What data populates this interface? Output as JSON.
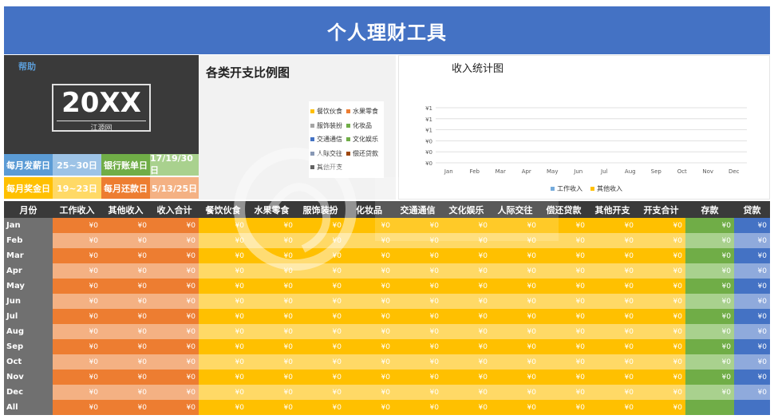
{
  "header": {
    "title": "个人理财工具"
  },
  "sidebar": {
    "help_label": "帮助",
    "year": "20XX",
    "year_sub": "江源网",
    "info": [
      {
        "label": "每月发薪日",
        "value": "25~30日",
        "label_color": "#5b9bd5",
        "value_color": "#9dc3e6"
      },
      {
        "label": "银行账单日",
        "value": "17/19/30日",
        "label_color": "#70ad47",
        "value_color": "#a9d18e"
      },
      {
        "label": "每月奖金日",
        "value": "19~23日",
        "label_color": "#ffc000",
        "value_color": "#ffd966"
      },
      {
        "label": "每月还款日",
        "value": "5/13/25日",
        "label_color": "#ed7d31",
        "value_color": "#f4b183"
      }
    ]
  },
  "pie_chart": {
    "title": "各类开支比例图",
    "legend": [
      {
        "label": "餐饮伙食",
        "color": "#ffc000"
      },
      {
        "label": "水果零食",
        "color": "#ed7d31"
      },
      {
        "label": "服饰装扮",
        "color": "#a5a5a5"
      },
      {
        "label": "化妆品",
        "color": "#70ad47"
      },
      {
        "label": "交通通信",
        "color": "#4472c4"
      },
      {
        "label": "文化娱乐",
        "color": "#70ad47"
      },
      {
        "label": "人际交往",
        "color": "#264478"
      },
      {
        "label": "偿还贷款",
        "color": "#9e480e"
      },
      {
        "label": "其他开支",
        "color": "#636363"
      }
    ]
  },
  "chart_data": {
    "type": "bar",
    "title": "收入统计图",
    "categories": [
      "Jan",
      "Feb",
      "Mar",
      "Apr",
      "May",
      "Jun",
      "Jul",
      "Aug",
      "Sep",
      "Oct",
      "Nov",
      "Dec"
    ],
    "y_tick_labels": [
      "¥1",
      "¥1",
      "¥1",
      "¥0",
      "¥0",
      "¥0"
    ],
    "series": [
      {
        "name": "工作收入",
        "color": "#5b9bd5",
        "values": [
          0,
          0,
          0,
          0,
          0,
          0,
          0,
          0,
          0,
          0,
          0,
          0
        ]
      },
      {
        "name": "其他收入",
        "color": "#ffc000",
        "values": [
          0,
          0,
          0,
          0,
          0,
          0,
          0,
          0,
          0,
          0,
          0,
          0
        ]
      }
    ],
    "grid": true,
    "legend_position": "bottom"
  },
  "table": {
    "columns": [
      {
        "label": "月份",
        "color": "#707070",
        "alt": "#707070"
      },
      {
        "label": "工作收入",
        "color": "#ed7d31",
        "alt": "#f4b183"
      },
      {
        "label": "其他收入",
        "color": "#ed7d31",
        "alt": "#f4b183"
      },
      {
        "label": "收入合计",
        "color": "#ed7d31",
        "alt": "#f4b183"
      },
      {
        "label": "餐饮伙食",
        "color": "#ffc000",
        "alt": "#ffd966"
      },
      {
        "label": "水果零食",
        "color": "#ffc000",
        "alt": "#ffd966"
      },
      {
        "label": "服饰装扮",
        "color": "#ffc000",
        "alt": "#ffd966"
      },
      {
        "label": "化妆品",
        "color": "#ffc000",
        "alt": "#ffd966"
      },
      {
        "label": "交通通信",
        "color": "#ffc000",
        "alt": "#ffd966"
      },
      {
        "label": "文化娱乐",
        "color": "#ffc000",
        "alt": "#ffd966"
      },
      {
        "label": "人际交往",
        "color": "#ffc000",
        "alt": "#ffd966"
      },
      {
        "label": "偿还贷款",
        "color": "#ffc000",
        "alt": "#ffd966"
      },
      {
        "label": "其他开支",
        "color": "#ffc000",
        "alt": "#ffd966"
      },
      {
        "label": "开支合计",
        "color": "#ffc000",
        "alt": "#ffd966"
      },
      {
        "label": "存款",
        "color": "#70ad47",
        "alt": "#a9d18e"
      },
      {
        "label": "贷款",
        "color": "#4472c4",
        "alt": "#8faadc"
      }
    ],
    "rows": [
      {
        "month": "Jan",
        "values": [
          "¥0",
          "¥0",
          "¥0",
          "¥0",
          "¥0",
          "¥0",
          "¥0",
          "¥0",
          "¥0",
          "¥0",
          "¥0",
          "¥0",
          "¥0",
          "¥0",
          "¥0"
        ]
      },
      {
        "month": "Feb",
        "values": [
          "¥0",
          "¥0",
          "¥0",
          "¥0",
          "¥0",
          "¥0",
          "¥0",
          "¥0",
          "¥0",
          "¥0",
          "¥0",
          "¥0",
          "¥0",
          "¥0",
          "¥0"
        ]
      },
      {
        "month": "Mar",
        "values": [
          "¥0",
          "¥0",
          "¥0",
          "¥0",
          "¥0",
          "¥0",
          "¥0",
          "¥0",
          "¥0",
          "¥0",
          "¥0",
          "¥0",
          "¥0",
          "¥0",
          "¥0"
        ]
      },
      {
        "month": "Apr",
        "values": [
          "¥0",
          "¥0",
          "¥0",
          "¥0",
          "¥0",
          "¥0",
          "¥0",
          "¥0",
          "¥0",
          "¥0",
          "¥0",
          "¥0",
          "¥0",
          "¥0",
          "¥0"
        ]
      },
      {
        "month": "May",
        "values": [
          "¥0",
          "¥0",
          "¥0",
          "¥0",
          "¥0",
          "¥0",
          "¥0",
          "¥0",
          "¥0",
          "¥0",
          "¥0",
          "¥0",
          "¥0",
          "¥0",
          "¥0"
        ]
      },
      {
        "month": "Jun",
        "values": [
          "¥0",
          "¥0",
          "¥0",
          "¥0",
          "¥0",
          "¥0",
          "¥0",
          "¥0",
          "¥0",
          "¥0",
          "¥0",
          "¥0",
          "¥0",
          "¥0",
          "¥0"
        ]
      },
      {
        "month": "Jul",
        "values": [
          "¥0",
          "¥0",
          "¥0",
          "¥0",
          "¥0",
          "¥0",
          "¥0",
          "¥0",
          "¥0",
          "¥0",
          "¥0",
          "¥0",
          "¥0",
          "¥0",
          "¥0"
        ]
      },
      {
        "month": "Aug",
        "values": [
          "¥0",
          "¥0",
          "¥0",
          "¥0",
          "¥0",
          "¥0",
          "¥0",
          "¥0",
          "¥0",
          "¥0",
          "¥0",
          "¥0",
          "¥0",
          "¥0",
          "¥0"
        ]
      },
      {
        "month": "Sep",
        "values": [
          "¥0",
          "¥0",
          "¥0",
          "¥0",
          "¥0",
          "¥0",
          "¥0",
          "¥0",
          "¥0",
          "¥0",
          "¥0",
          "¥0",
          "¥0",
          "¥0",
          "¥0"
        ]
      },
      {
        "month": "Oct",
        "values": [
          "¥0",
          "¥0",
          "¥0",
          "¥0",
          "¥0",
          "¥0",
          "¥0",
          "¥0",
          "¥0",
          "¥0",
          "¥0",
          "¥0",
          "¥0",
          "¥0",
          "¥0"
        ]
      },
      {
        "month": "Nov",
        "values": [
          "¥0",
          "¥0",
          "¥0",
          "¥0",
          "¥0",
          "¥0",
          "¥0",
          "¥0",
          "¥0",
          "¥0",
          "¥0",
          "¥0",
          "¥0",
          "¥0",
          "¥0"
        ]
      },
      {
        "month": "Dec",
        "values": [
          "¥0",
          "¥0",
          "¥0",
          "¥0",
          "¥0",
          "¥0",
          "¥0",
          "¥0",
          "¥0",
          "¥0",
          "¥0",
          "¥0",
          "¥0",
          "¥0",
          "¥0"
        ]
      },
      {
        "month": "All",
        "values": [
          "¥0",
          "¥0",
          "¥0",
          "¥0",
          "¥0",
          "¥0",
          "¥0",
          "¥0",
          "¥0",
          "¥0",
          "¥0",
          "¥0",
          "¥0",
          "",
          ""
        ]
      }
    ]
  }
}
